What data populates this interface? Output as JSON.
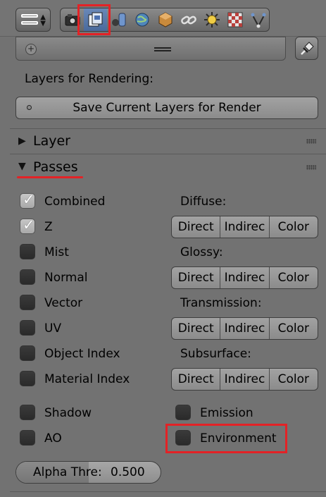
{
  "header": {
    "editor_type_icon": "buttons-icon",
    "context_tabs": [
      {
        "name": "render-icon",
        "color": "#3a3a3a",
        "active": false
      },
      {
        "name": "render-layers-icon",
        "color": "#d9e2f2",
        "active": true
      },
      {
        "name": "scene-icon",
        "color": "#5f7fb6",
        "active": false
      },
      {
        "name": "world-icon",
        "color": "#4c7fb0",
        "active": false
      },
      {
        "name": "object-icon",
        "color": "#c68a3a",
        "active": false
      },
      {
        "name": "constraints-icon",
        "color": "#d0d0d0",
        "active": false
      },
      {
        "name": "light-icon",
        "color": "#e8c43a",
        "active": false
      },
      {
        "name": "texture-icon",
        "color": "#b23a3a",
        "active": false
      },
      {
        "name": "data-icon",
        "color": "#6b8fc4",
        "active": false
      }
    ],
    "pin_icon": "pin-icon",
    "add_icon_symbol": "+"
  },
  "layers": {
    "heading": "Layers for Rendering:",
    "save_button": "Save Current Layers for Render"
  },
  "panels": {
    "layer_title": "Layer",
    "passes_title": "Passes"
  },
  "passes_left": [
    {
      "label": "Combined",
      "checked": true
    },
    {
      "label": "Z",
      "checked": true
    },
    {
      "label": "Mist",
      "checked": false
    },
    {
      "label": "Normal",
      "checked": false
    },
    {
      "label": "Vector",
      "checked": false
    },
    {
      "label": "UV",
      "checked": false
    },
    {
      "label": "Object Index",
      "checked": false
    },
    {
      "label": "Material Index",
      "checked": false
    }
  ],
  "passes_right": [
    {
      "heading": "Diffuse:",
      "options": [
        "Direct",
        "Indirec",
        "Color"
      ]
    },
    {
      "heading": "Glossy:",
      "options": [
        "Direct",
        "Indirec",
        "Color"
      ]
    },
    {
      "heading": "Transmission:",
      "options": [
        "Direct",
        "Indirec",
        "Color"
      ]
    },
    {
      "heading": "Subsurface:",
      "options": [
        "Direct",
        "Indirec",
        "Color"
      ]
    }
  ],
  "extra_passes": [
    {
      "label": "Shadow",
      "checked": false
    },
    {
      "label": "AO",
      "checked": false
    },
    {
      "label": "Emission",
      "checked": false
    },
    {
      "label": "Environment",
      "checked": false
    }
  ],
  "alpha_threshold": {
    "label": "Alpha Thre:",
    "value": "0.500",
    "fraction": 0.5
  },
  "colors": {
    "highlight": "#e32226",
    "panel_bg": "#727272",
    "active_tab": "#5677ab"
  }
}
